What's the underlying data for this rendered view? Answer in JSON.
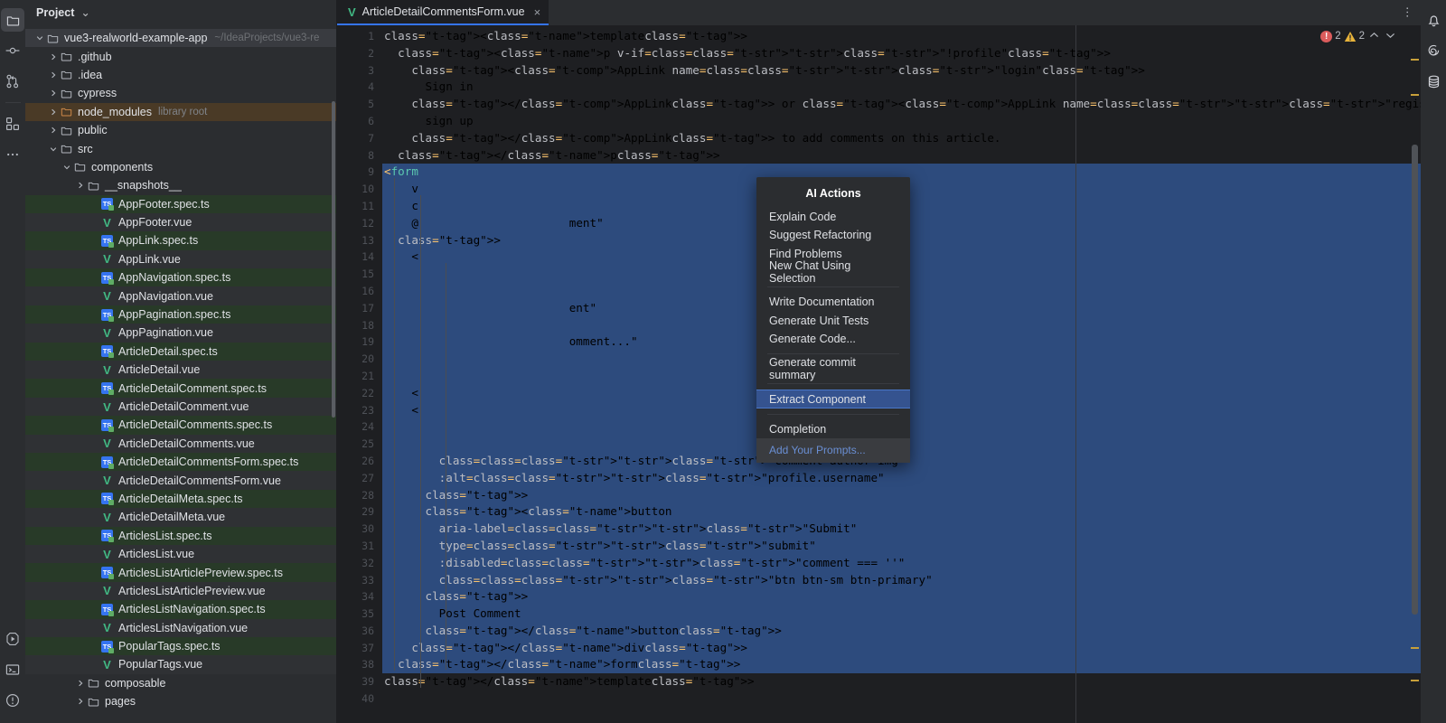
{
  "left_rail": {
    "items": [
      {
        "name": "project-folder-icon",
        "label": "Project",
        "active": true
      },
      {
        "name": "commit-icon",
        "label": "Commit",
        "active": false
      },
      {
        "name": "pull-requests-icon",
        "label": "Pull Requests",
        "active": false
      },
      {
        "name": "plugins-icon",
        "label": "Plugins",
        "active": false
      },
      {
        "name": "more-tool-windows-icon",
        "label": "More",
        "active": false
      }
    ],
    "bottom_items": [
      {
        "name": "run-icon",
        "label": "Run"
      },
      {
        "name": "terminal-icon",
        "label": "Terminal"
      },
      {
        "name": "problems-icon",
        "label": "Problems"
      }
    ]
  },
  "project_panel": {
    "title": "Project",
    "title_chevron": "⌄",
    "tree": [
      {
        "indent": 0,
        "arrow": "down",
        "icon": "folder",
        "label": "vue3-realworld-example-app",
        "path": "~/IdeaProjects/vue3-re",
        "style": "sel"
      },
      {
        "indent": 1,
        "arrow": "right",
        "icon": "folder",
        "label": ".github",
        "style": ""
      },
      {
        "indent": 1,
        "arrow": "right",
        "icon": "folder",
        "label": ".idea",
        "style": ""
      },
      {
        "indent": 1,
        "arrow": "right",
        "icon": "folder",
        "label": "cypress",
        "style": ""
      },
      {
        "indent": 1,
        "arrow": "right",
        "icon": "folder-orange",
        "label": "node_modules",
        "sub": "library root",
        "style": "lib"
      },
      {
        "indent": 1,
        "arrow": "right",
        "icon": "folder",
        "label": "public",
        "style": ""
      },
      {
        "indent": 1,
        "arrow": "down",
        "icon": "folder",
        "label": "src",
        "style": ""
      },
      {
        "indent": 2,
        "arrow": "down",
        "icon": "folder",
        "label": "components",
        "style": ""
      },
      {
        "indent": 3,
        "arrow": "right",
        "icon": "folder",
        "label": "__snapshots__",
        "style": ""
      },
      {
        "indent": 4,
        "arrow": "none",
        "icon": "ts",
        "label": "AppFooter.spec.ts",
        "style": "greenA"
      },
      {
        "indent": 4,
        "arrow": "none",
        "icon": "vue",
        "label": "AppFooter.vue",
        "style": "greenB"
      },
      {
        "indent": 4,
        "arrow": "none",
        "icon": "ts",
        "label": "AppLink.spec.ts",
        "style": "greenA"
      },
      {
        "indent": 4,
        "arrow": "none",
        "icon": "vue",
        "label": "AppLink.vue",
        "style": "greenB"
      },
      {
        "indent": 4,
        "arrow": "none",
        "icon": "ts",
        "label": "AppNavigation.spec.ts",
        "style": "greenA"
      },
      {
        "indent": 4,
        "arrow": "none",
        "icon": "vue",
        "label": "AppNavigation.vue",
        "style": "greenB"
      },
      {
        "indent": 4,
        "arrow": "none",
        "icon": "ts",
        "label": "AppPagination.spec.ts",
        "style": "greenA"
      },
      {
        "indent": 4,
        "arrow": "none",
        "icon": "vue",
        "label": "AppPagination.vue",
        "style": "greenB"
      },
      {
        "indent": 4,
        "arrow": "none",
        "icon": "ts",
        "label": "ArticleDetail.spec.ts",
        "style": "greenA"
      },
      {
        "indent": 4,
        "arrow": "none",
        "icon": "vue",
        "label": "ArticleDetail.vue",
        "style": "greenB"
      },
      {
        "indent": 4,
        "arrow": "none",
        "icon": "ts",
        "label": "ArticleDetailComment.spec.ts",
        "style": "greenA"
      },
      {
        "indent": 4,
        "arrow": "none",
        "icon": "vue",
        "label": "ArticleDetailComment.vue",
        "style": "greenB"
      },
      {
        "indent": 4,
        "arrow": "none",
        "icon": "ts",
        "label": "ArticleDetailComments.spec.ts",
        "style": "greenA"
      },
      {
        "indent": 4,
        "arrow": "none",
        "icon": "vue",
        "label": "ArticleDetailComments.vue",
        "style": "greenB"
      },
      {
        "indent": 4,
        "arrow": "none",
        "icon": "ts",
        "label": "ArticleDetailCommentsForm.spec.ts",
        "style": "greenA"
      },
      {
        "indent": 4,
        "arrow": "none",
        "icon": "vue",
        "label": "ArticleDetailCommentsForm.vue",
        "style": "greenB"
      },
      {
        "indent": 4,
        "arrow": "none",
        "icon": "ts",
        "label": "ArticleDetailMeta.spec.ts",
        "style": "greenA"
      },
      {
        "indent": 4,
        "arrow": "none",
        "icon": "vue",
        "label": "ArticleDetailMeta.vue",
        "style": "greenB"
      },
      {
        "indent": 4,
        "arrow": "none",
        "icon": "ts",
        "label": "ArticlesList.spec.ts",
        "style": "greenA"
      },
      {
        "indent": 4,
        "arrow": "none",
        "icon": "vue",
        "label": "ArticlesList.vue",
        "style": "greenB"
      },
      {
        "indent": 4,
        "arrow": "none",
        "icon": "ts",
        "label": "ArticlesListArticlePreview.spec.ts",
        "style": "greenA"
      },
      {
        "indent": 4,
        "arrow": "none",
        "icon": "vue",
        "label": "ArticlesListArticlePreview.vue",
        "style": "greenB"
      },
      {
        "indent": 4,
        "arrow": "none",
        "icon": "ts",
        "label": "ArticlesListNavigation.spec.ts",
        "style": "greenA"
      },
      {
        "indent": 4,
        "arrow": "none",
        "icon": "vue",
        "label": "ArticlesListNavigation.vue",
        "style": "greenB"
      },
      {
        "indent": 4,
        "arrow": "none",
        "icon": "ts",
        "label": "PopularTags.spec.ts",
        "style": "greenA"
      },
      {
        "indent": 4,
        "arrow": "none",
        "icon": "vue",
        "label": "PopularTags.vue",
        "style": "greenB"
      },
      {
        "indent": 3,
        "arrow": "right",
        "icon": "folder",
        "label": "composable",
        "style": ""
      },
      {
        "indent": 3,
        "arrow": "right",
        "icon": "folder",
        "label": "pages",
        "style": ""
      }
    ]
  },
  "editor": {
    "tab": {
      "label": "ArticleDetailCommentsForm.vue",
      "icon": "vue-file-icon",
      "close": "×"
    },
    "tab_overflow_icon": "more-options-icon",
    "inspections": {
      "error_count": "2",
      "warning_count": "2",
      "prev_icon": "chevron-up-icon",
      "next_icon": "chevron-down-icon"
    },
    "line_numbers": [
      "1",
      "2",
      "3",
      "4",
      "5",
      "6",
      "7",
      "8",
      "9",
      "10",
      "11",
      "12",
      "13",
      "14",
      "15",
      "16",
      "17",
      "18",
      "19",
      "20",
      "21",
      "22",
      "23",
      "24",
      "25",
      "26",
      "27",
      "28",
      "29",
      "30",
      "31",
      "32",
      "33",
      "34",
      "35",
      "36",
      "37",
      "38",
      "39",
      "40"
    ],
    "code_lines": [
      {
        "n": 1,
        "sel": false,
        "text": "<template>"
      },
      {
        "n": 2,
        "sel": false,
        "text": "  <p v-if=\"!profile\">"
      },
      {
        "n": 3,
        "sel": false,
        "text": "    <AppLink name=\"login\">"
      },
      {
        "n": 4,
        "sel": false,
        "text": "      Sign in"
      },
      {
        "n": 5,
        "sel": false,
        "text": "    </AppLink> or <AppLink name=\"register\">"
      },
      {
        "n": 6,
        "sel": false,
        "text": "      sign up"
      },
      {
        "n": 7,
        "sel": false,
        "text": "    </AppLink> to add comments on this article."
      },
      {
        "n": 8,
        "sel": false,
        "text": "  </p>"
      },
      {
        "n": 9,
        "sel": true,
        "text": "  <form"
      },
      {
        "n": 10,
        "sel": true,
        "text": "    v"
      },
      {
        "n": 11,
        "sel": true,
        "text": "    c"
      },
      {
        "n": 12,
        "sel": true,
        "text": "    @                      ment\""
      },
      {
        "n": 13,
        "sel": true,
        "text": "  >"
      },
      {
        "n": 14,
        "sel": true,
        "text": "    <"
      },
      {
        "n": 15,
        "sel": true,
        "text": ""
      },
      {
        "n": 16,
        "sel": true,
        "text": ""
      },
      {
        "n": 17,
        "sel": true,
        "text": "                           ent\""
      },
      {
        "n": 18,
        "sel": true,
        "text": ""
      },
      {
        "n": 19,
        "sel": true,
        "text": "                           omment...\""
      },
      {
        "n": 20,
        "sel": true,
        "text": ""
      },
      {
        "n": 21,
        "sel": true,
        "text": ""
      },
      {
        "n": 22,
        "sel": true,
        "text": "    <"
      },
      {
        "n": 23,
        "sel": true,
        "text": "    <"
      },
      {
        "n": 24,
        "sel": true,
        "text": ""
      },
      {
        "n": 25,
        "sel": true,
        "text": ""
      },
      {
        "n": 26,
        "sel": true,
        "text": "        class=\"comment-author-img\""
      },
      {
        "n": 27,
        "sel": true,
        "text": "        :alt=\"profile.username\""
      },
      {
        "n": 28,
        "sel": true,
        "text": "      >"
      },
      {
        "n": 29,
        "sel": true,
        "text": "      <button"
      },
      {
        "n": 30,
        "sel": true,
        "text": "        aria-label=\"Submit\""
      },
      {
        "n": 31,
        "sel": true,
        "text": "        type=\"submit\""
      },
      {
        "n": 32,
        "sel": true,
        "text": "        :disabled=\"comment === ''\""
      },
      {
        "n": 33,
        "sel": true,
        "text": "        class=\"btn btn-sm btn-primary\""
      },
      {
        "n": 34,
        "sel": true,
        "text": "      >"
      },
      {
        "n": 35,
        "sel": true,
        "text": "        Post Comment"
      },
      {
        "n": 36,
        "sel": true,
        "text": "      </button>"
      },
      {
        "n": 37,
        "sel": true,
        "text": "    </div>"
      },
      {
        "n": 38,
        "sel": true,
        "text": "  </form>"
      },
      {
        "n": 39,
        "sel": false,
        "text": "</template>"
      },
      {
        "n": 40,
        "sel": false,
        "text": ""
      }
    ]
  },
  "ai_popup": {
    "title": "AI Actions",
    "groups": [
      [
        "Explain Code",
        "Suggest Refactoring",
        "Find Problems",
        "New Chat Using Selection"
      ],
      [
        "Write Documentation",
        "Generate Unit Tests",
        "Generate Code..."
      ],
      [
        "Generate commit summary"
      ],
      [
        "Extract Component"
      ],
      [
        "Completion"
      ]
    ],
    "highlighted_item": "Extract Component",
    "footer": "Add Your Prompts..."
  },
  "right_rail": {
    "items": [
      {
        "name": "notifications-bell-icon",
        "label": "Notifications"
      },
      {
        "name": "ai-assistant-icon",
        "label": "AI Assistant"
      },
      {
        "name": "database-icon",
        "label": "Database"
      }
    ]
  },
  "colors": {
    "accent_blue": "#3574f0",
    "selection_blue": "#2d4b7d",
    "highlight_blue": "#35538f",
    "vue_green": "#41b883",
    "error_red": "#db5c5c",
    "warning_yellow": "#e8b33a",
    "panel_bg": "#2b2d30",
    "editor_bg": "#1e1f22"
  }
}
